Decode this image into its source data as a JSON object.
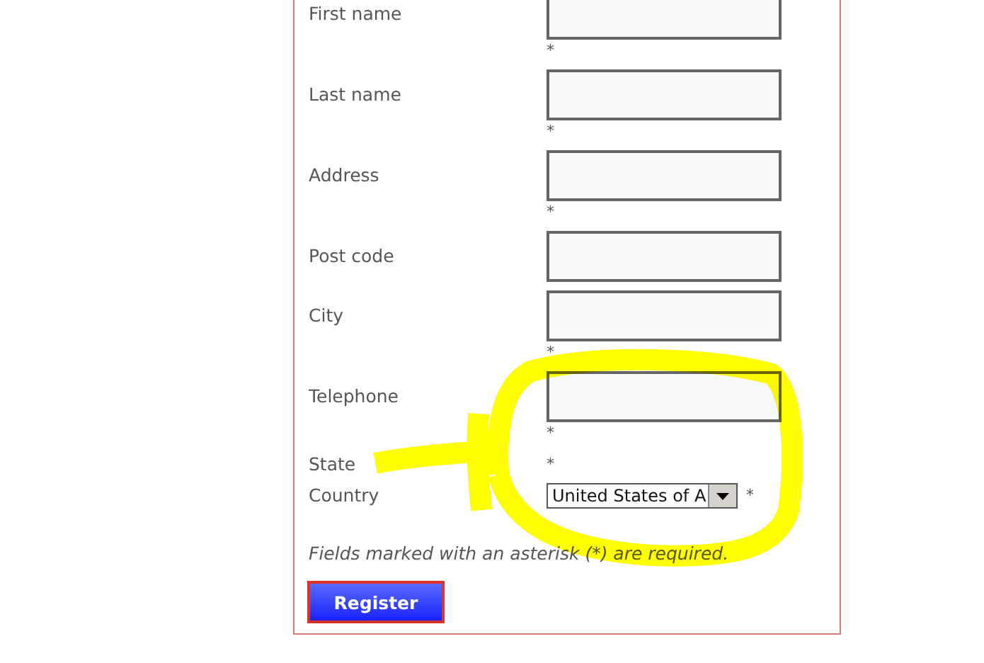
{
  "form": {
    "fields": [
      {
        "label": "First name",
        "kind": "text",
        "required": true
      },
      {
        "label": "Last name",
        "kind": "text",
        "required": true
      },
      {
        "label": "Address",
        "kind": "text",
        "required": true
      },
      {
        "label": "Post code",
        "kind": "text",
        "required": false
      },
      {
        "label": "City",
        "kind": "text",
        "required": true
      },
      {
        "label": "Telephone",
        "kind": "text",
        "required": true
      },
      {
        "label": "State",
        "kind": "none",
        "required": true
      },
      {
        "label": "Country",
        "kind": "select",
        "value": "United States of A",
        "required": true
      }
    ],
    "required_marker": "*",
    "note": "Fields marked with an asterisk (*) are required.",
    "submit": "Register"
  }
}
